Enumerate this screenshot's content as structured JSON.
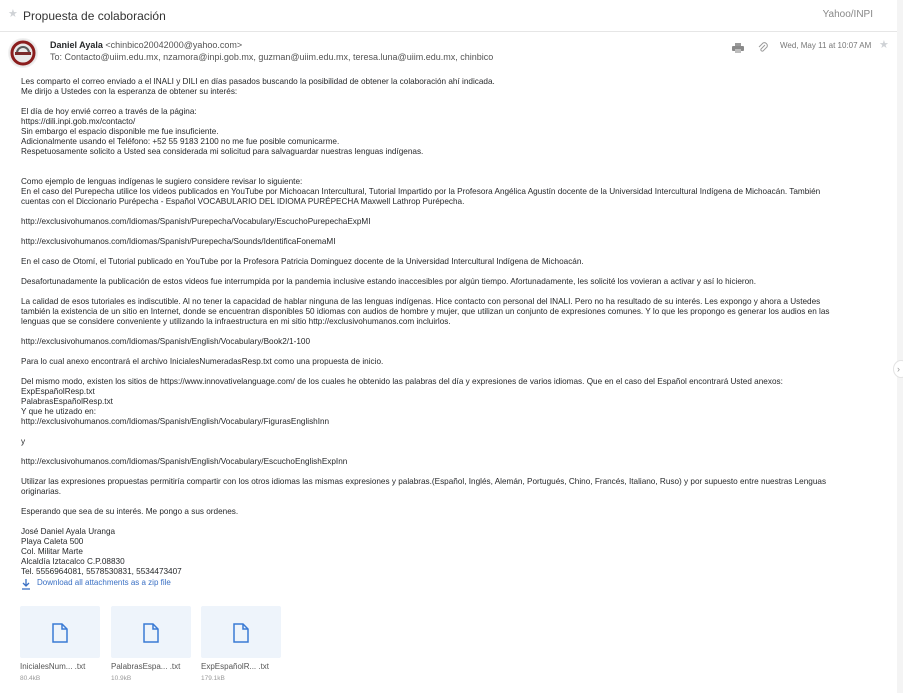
{
  "subject": {
    "title": "Propuesta de colaboración",
    "folder": "Yahoo/INPI"
  },
  "header": {
    "sender_name": "Daniel Ayala",
    "sender_email": "<chinbico20042000@yahoo.com>",
    "to_line": "To: Contacto@uiim.edu.mx,  nzamora@inpi.gob.mx,  guzman@uiim.edu.mx,  teresa.luna@uiim.edu.mx,  chinbico",
    "date": "Wed, May 11 at 10:07 AM"
  },
  "body": {
    "lines": [
      "Les comparto el correo enviado a el INALI y DILI en días pasados buscando la posibilidad de obtener la colaboración ahí indicada.",
      "Me dirijo a Ustedes con la esperanza de obtener su interés:",
      "",
      "El día de hoy envié correo a través de la página:",
      "https://dili.inpi.gob.mx/contacto/",
      "Sin embargo el espacio disponible me fue insuficiente.",
      "Adicionalmente usando el Teléfono: +52 55 9183 2100 no me fue posible comunicarme.",
      "Respetuosamente solicito a Usted sea considerada mi solicitud para salvaguardar nuestras lenguas indígenas.",
      "",
      "",
      "Como ejemplo de lenguas indígenas le sugiero considere revisar lo siguiente:",
      "En el caso del Purepecha utilice los videos publicados en YouTube por Michoacan Intercultural, Tutorial Impartido por la Profesora Angélica Agustín docente de la Universidad Intercultural Indígena de Michoacán. También",
      "cuentas con el Diccionario Purépecha - Español VOCABULARIO DEL IDIOMA PURÉPECHA Maxwell Lathrop Purépecha.",
      "",
      "http://exclusivohumanos.com/Idiomas/Spanish/Purepecha/Vocabulary/EscuchoPurepechaExpMI",
      "",
      "http://exclusivohumanos.com/Idiomas/Spanish/Purepecha/Sounds/IdentificaFonemaMI",
      "",
      "En el caso de Otomí, el Tutorial publicado en YouTube por la Profesora Patricia Dominguez docente de la Universidad Intercultural Indígena de Michoacán.",
      "",
      "Desafortunadamente la publicación de estos videos fue interrumpida por la pandemia inclusive estando inaccesibles por algún tiempo. Afortunadamente, les solicité los vovieran a activar y así lo hicieron.",
      "",
      "La calidad de esos tutoriales es indiscutible. Al no tener la capacidad de hablar ninguna de las lenguas indígenas. Hice contacto con personal del INALI. Pero no ha resultado de su interés. Les expongo y ahora a Ustedes",
      "también la existencia de un sitio en Internet, donde se encuentran disponibles 50 idiomas con audios de hombre y mujer, que utilizan un conjunto de expresiones comunes. Y lo que les propongo es generar los audios en las",
      "lenguas que se considere conveniente y utilizando la infraestructura en mi sitio http://exclusivohumanos.com incluirlos.",
      "",
      "http://exclusivohumanos.com/Idiomas/Spanish/English/Vocabulary/Book2/1-100",
      "",
      "Para lo cual anexo encontrará el archivo InicialesNumeradasResp.txt como una propuesta de inicio.",
      "",
      "Del mismo modo, existen los sitios de https://www.innovativelanguage.com/ de los cuales he obtenido las palabras del día y expresiones de varios idiomas. Que en el caso del Español encontrará Usted anexos:",
      "ExpEspañolResp.txt",
      "PalabrasEspañolResp.txt",
      "Y que he utizado en:",
      "http://exclusivohumanos.com/Idiomas/Spanish/English/Vocabulary/FigurasEnglishInn",
      "",
      "y",
      "",
      "http://exclusivohumanos.com/Idiomas/Spanish/English/Vocabulary/EscuchoEnglishExpInn",
      "",
      "Utilizar las expresiones propuestas permitiría compartir con los otros idiomas las mismas expresiones y palabras.(Español, Inglés, Alemán, Portugués, Chino, Francés, Italiano, Ruso) y por supuesto entre nuestras Lenguas",
      "originarias.",
      "",
      "Esperando que sea de su interés. Me pongo a sus ordenes.",
      "",
      "José Daniel Ayala Uranga",
      "Playa Caleta 500",
      "Col. Militar Marte",
      "Alcaldía Iztacalco C.P.08830",
      "Tel. 5556964081, 5578530831, 5534473407"
    ]
  },
  "attachments": {
    "download_all": "Download all attachments as a zip file",
    "files": [
      {
        "name": "InicialesNum... .txt",
        "size": "80.4kB"
      },
      {
        "name": "PalabrasEspa... .txt",
        "size": "10.9kB"
      },
      {
        "name": "ExpEspañolR... .txt",
        "size": "179.1kB"
      }
    ]
  },
  "icons": [
    "star-icon",
    "print-icon",
    "paperclip-icon",
    "download-icon",
    "file-icon",
    "chevron-right-icon"
  ],
  "colors": {
    "link": "#3a70c4",
    "tile_bg": "#eef4fb",
    "file_icon": "#3a7bd5"
  }
}
